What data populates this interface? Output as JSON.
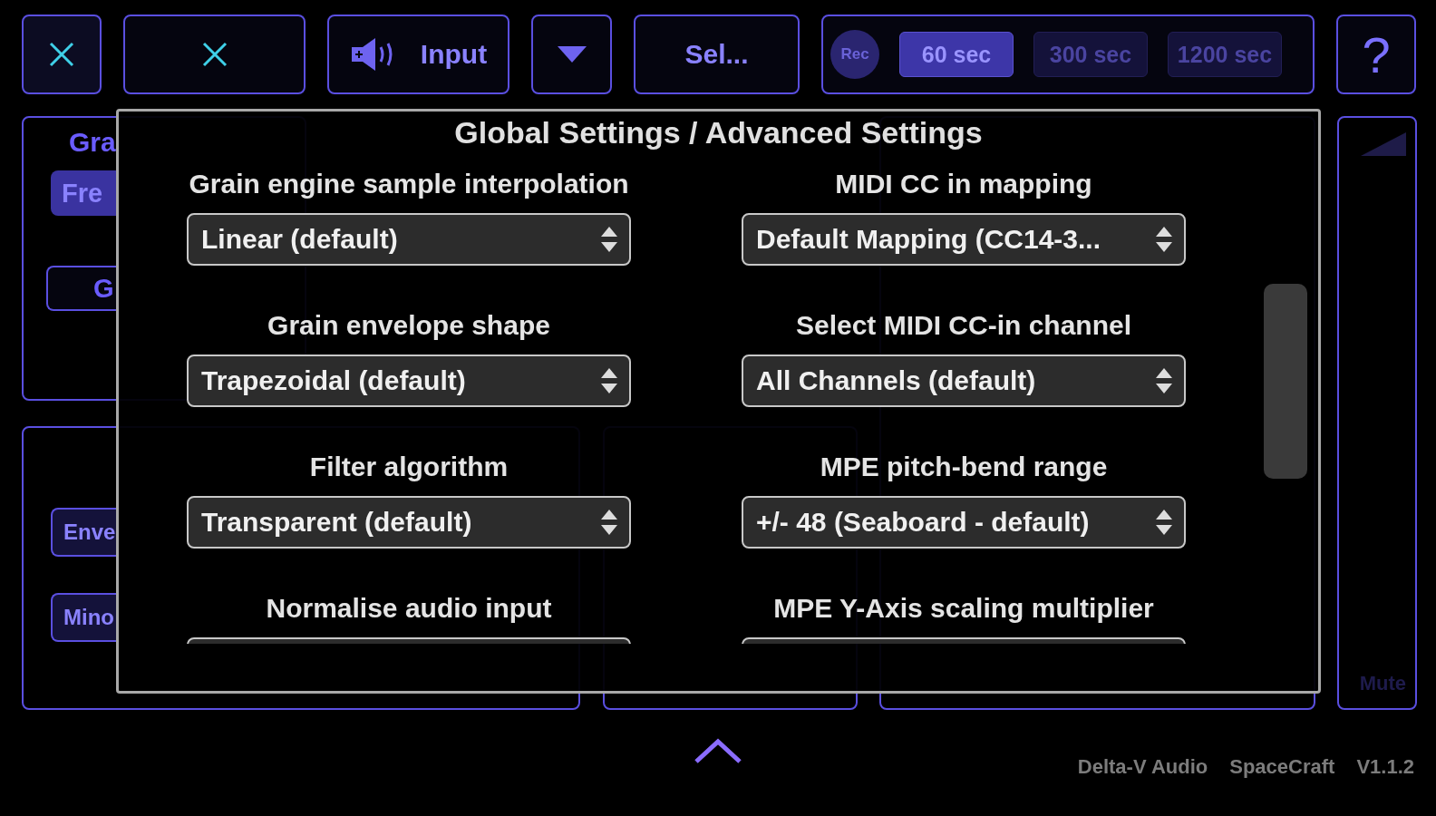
{
  "toolbar": {
    "input_button": {
      "label": "Input"
    },
    "select_button": {
      "label": "Sel..."
    },
    "record": {
      "label": "Rec",
      "durations": [
        {
          "label": "60 sec",
          "selected": true
        },
        {
          "label": "300 sec",
          "selected": false
        },
        {
          "label": "1200 sec",
          "selected": false
        }
      ]
    },
    "help_button": {
      "label": "?"
    }
  },
  "background": {
    "grain_panel": {
      "title": "Gra",
      "buttons": [
        {
          "label": "Fre",
          "kind": "filled"
        },
        {
          "label": "G",
          "kind": "outline"
        }
      ]
    },
    "sequencer_panel": {
      "buttons": [
        {
          "label": "Enve",
          "kind": "filled"
        },
        {
          "label": "Mino",
          "kind": "filled"
        }
      ]
    },
    "volume_panel": {
      "label": "Mute"
    }
  },
  "modal": {
    "title": "Global Settings / Advanced Settings",
    "columns": [
      [
        {
          "label": "Grain engine sample interpolation",
          "value": "Linear (default)"
        },
        {
          "label": "Grain envelope shape",
          "value": "Trapezoidal (default)"
        },
        {
          "label": "Filter algorithm",
          "value": "Transparent (default)"
        },
        {
          "label": "Normalise audio input"
        }
      ],
      [
        {
          "label": "MIDI CC in mapping",
          "value": "Default Mapping (CC14-3..."
        },
        {
          "label": "Select MIDI CC-in channel",
          "value": "All Channels (default)"
        },
        {
          "label": "MPE pitch-bend range",
          "value": "+/- 48 (Seaboard - default)"
        },
        {
          "label": "MPE Y-Axis scaling multiplier"
        }
      ]
    ]
  },
  "footer": [
    {
      "text": "Delta-V Audio"
    },
    {
      "text": "SpaceCraft"
    },
    {
      "text": "V1.1.2"
    }
  ]
}
